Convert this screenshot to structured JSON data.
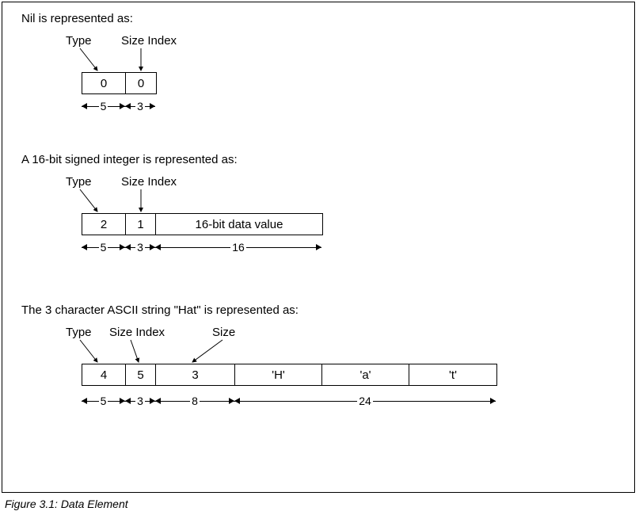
{
  "caption": "Figure 3.1:  Data Element",
  "sections": {
    "nil": {
      "intro": "Nil is represented as:",
      "labels": {
        "type": "Type",
        "sizeIndex": "Size Index"
      },
      "cells": {
        "type": "0",
        "sizeIndex": "0"
      },
      "dims": {
        "type": "5",
        "sizeIndex": "3"
      }
    },
    "int16": {
      "intro": "A 16-bit signed integer is represented as:",
      "labels": {
        "type": "Type",
        "sizeIndex": "Size Index"
      },
      "cells": {
        "type": "2",
        "sizeIndex": "1",
        "data": "16-bit data value"
      },
      "dims": {
        "type": "5",
        "sizeIndex": "3",
        "data": "16"
      }
    },
    "ascii": {
      "intro": "The 3 character ASCII string \"Hat\" is represented as:",
      "labels": {
        "type": "Type",
        "sizeIndex": "Size Index",
        "size": "Size"
      },
      "cells": {
        "type": "4",
        "sizeIndex": "5",
        "size": "3",
        "c0": "'H'",
        "c1": "'a'",
        "c2": "'t'"
      },
      "dims": {
        "type": "5",
        "sizeIndex": "3",
        "size": "8",
        "data": "24"
      }
    }
  }
}
